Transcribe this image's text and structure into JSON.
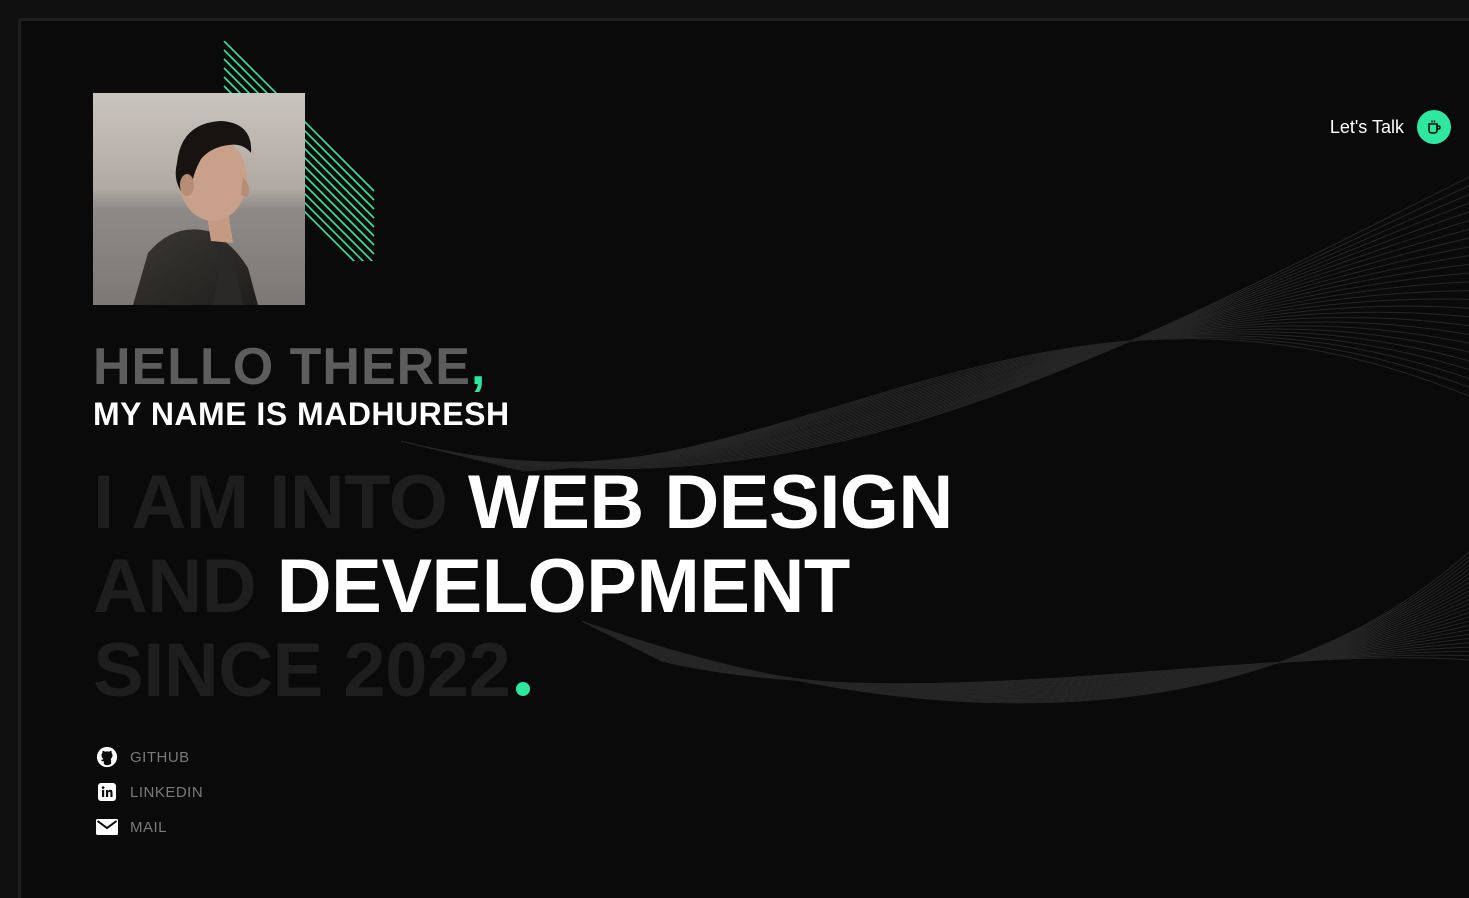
{
  "header": {
    "cta_label": "Let's Talk",
    "cta_icon": "coffee-cup-icon"
  },
  "intro": {
    "greeting": "HELLO THERE",
    "greeting_punct": ",",
    "name_line": "MY NAME IS MADHURESH"
  },
  "headline": {
    "line1_dim": "I AM INTO ",
    "line1_bright": "WEB DESIGN",
    "line2_dim": "AND ",
    "line2_bright": "DEVELOPMENT",
    "line3_dim": "SINCE 2022"
  },
  "socials": [
    {
      "label": "GITHUB",
      "icon": "github-icon"
    },
    {
      "label": "LINKEDIN",
      "icon": "linkedin-icon"
    },
    {
      "label": "MAIL",
      "icon": "mail-icon"
    }
  ],
  "colors": {
    "accent": "#2ee8a0",
    "background": "#0a0a0a",
    "greeting": "#5d5d5d",
    "dim_text": "#1e1e1e",
    "social_text": "#7a7a7a"
  }
}
